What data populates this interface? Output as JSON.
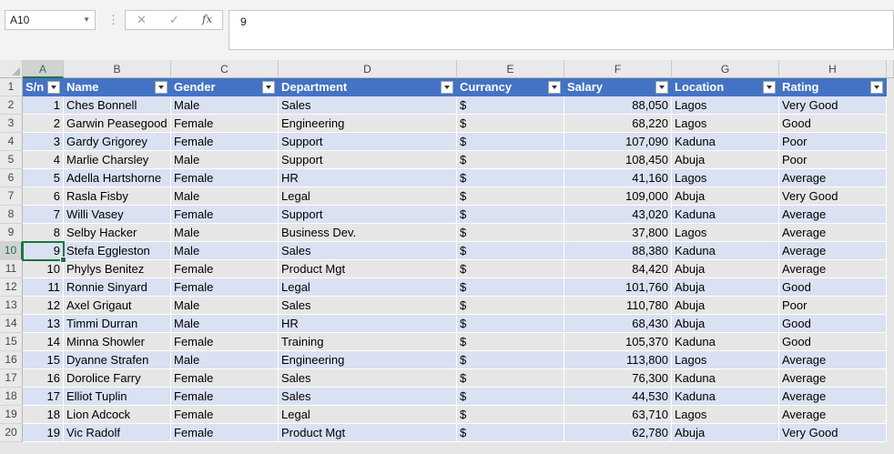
{
  "formula_bar": {
    "name_box": "A10",
    "dots": "⋮",
    "cancel": "✕",
    "enter": "✓",
    "fx": "fx",
    "value": "9"
  },
  "columns": [
    "A",
    "B",
    "C",
    "D",
    "E",
    "F",
    "G",
    "H"
  ],
  "selected_column": "A",
  "selected_row": 10,
  "headers": [
    "S/n",
    "Name",
    "Gender",
    "Department",
    "Currancy",
    "Salary",
    "Location",
    "Rating"
  ],
  "rows": [
    [
      "1",
      "Ches Bonnell",
      "Male",
      "Sales",
      "$",
      "88,050",
      "Lagos",
      "Very Good"
    ],
    [
      "2",
      "Garwin Peasegood",
      "Female",
      "Engineering",
      "$",
      "68,220",
      "Lagos",
      "Good"
    ],
    [
      "3",
      "Gardy Grigorey",
      "Female",
      "Support",
      "$",
      "107,090",
      "Kaduna",
      "Poor"
    ],
    [
      "4",
      "Marlie Charsley",
      "Male",
      "Support",
      "$",
      "108,450",
      "Abuja",
      "Poor"
    ],
    [
      "5",
      "Adella Hartshorne",
      "Female",
      "HR",
      "$",
      "41,160",
      "Lagos",
      "Average"
    ],
    [
      "6",
      "Rasla Fisby",
      "Male",
      "Legal",
      "$",
      "109,000",
      "Abuja",
      "Very Good"
    ],
    [
      "7",
      "Willi Vasey",
      "Female",
      "Support",
      "$",
      "43,020",
      "Kaduna",
      "Average"
    ],
    [
      "8",
      "Selby Hacker",
      "Male",
      "Business Dev.",
      "$",
      "37,800",
      "Lagos",
      "Average"
    ],
    [
      "9",
      "Stefa Eggleston",
      "Male",
      "Sales",
      "$",
      "88,380",
      "Kaduna",
      "Average"
    ],
    [
      "10",
      "Phylys Benitez",
      "Female",
      "Product Mgt",
      "$",
      "84,420",
      "Abuja",
      "Average"
    ],
    [
      "11",
      "Ronnie Sinyard",
      "Female",
      "Legal",
      "$",
      "101,760",
      "Abuja",
      "Good"
    ],
    [
      "12",
      "Axel Grigaut",
      "Male",
      "Sales",
      "$",
      "110,780",
      "Abuja",
      "Poor"
    ],
    [
      "13",
      "Timmi Durran",
      "Male",
      "HR",
      "$",
      "68,430",
      "Abuja",
      "Good"
    ],
    [
      "14",
      "Minna Showler",
      "Female",
      "Training",
      "$",
      "105,370",
      "Kaduna",
      "Good"
    ],
    [
      "15",
      "Dyanne Strafen",
      "Male",
      "Engineering",
      "$",
      "113,800",
      "Lagos",
      "Average"
    ],
    [
      "16",
      "Dorolice Farry",
      "Female",
      "Sales",
      "$",
      "76,300",
      "Kaduna",
      "Average"
    ],
    [
      "17",
      "Elliot Tuplin",
      "Female",
      "Sales",
      "$",
      "44,530",
      "Kaduna",
      "Average"
    ],
    [
      "18",
      "Lion Adcock",
      "Female",
      "Legal",
      "$",
      "63,710",
      "Lagos",
      "Average"
    ],
    [
      "19",
      "Vic Radolf",
      "Female",
      "Product Mgt",
      "$",
      "62,780",
      "Abuja",
      "Very Good"
    ]
  ],
  "colors": {
    "header_fill": "#4472c4",
    "band_fill": "#d9e1f2",
    "selection": "#217346"
  }
}
